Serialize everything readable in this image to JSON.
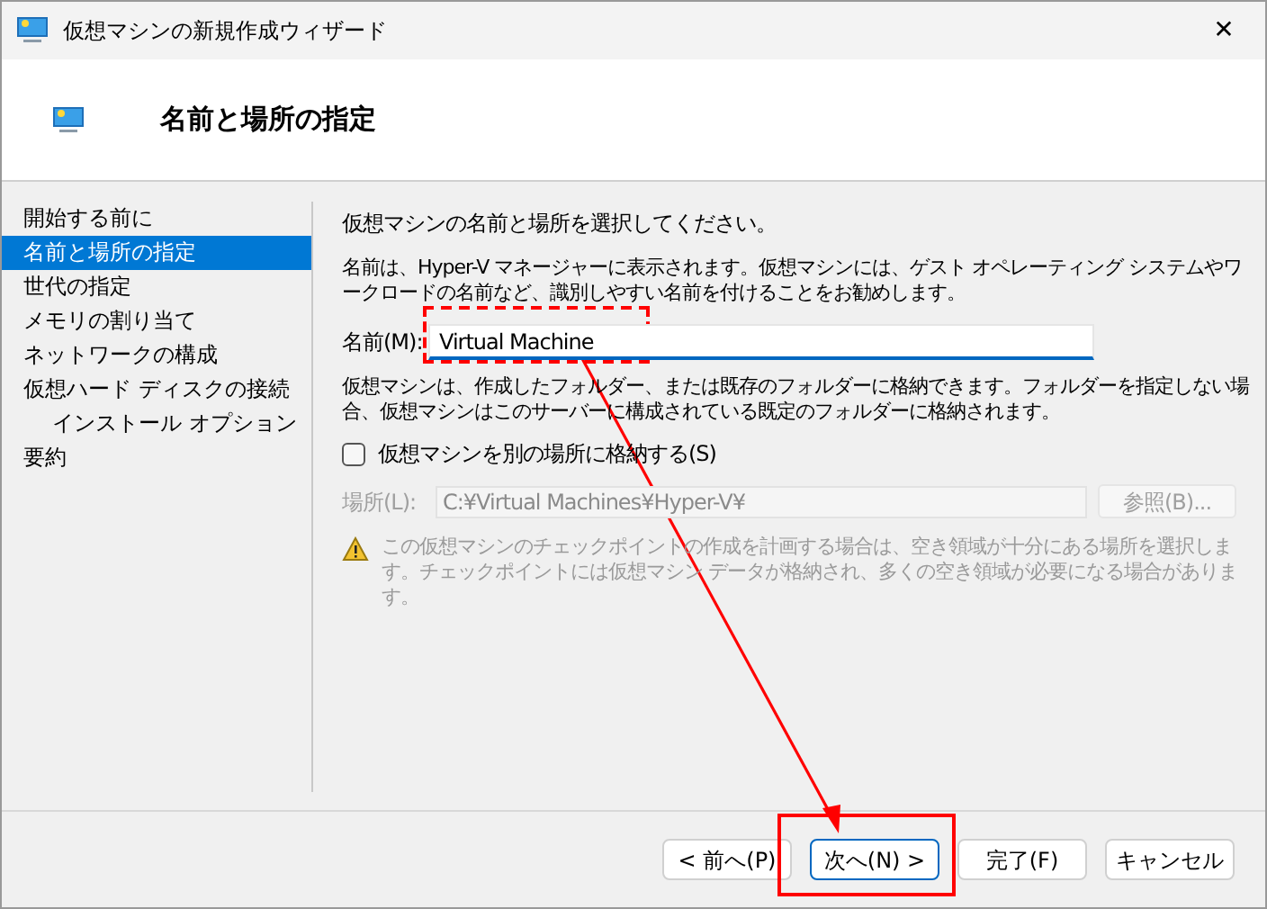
{
  "window": {
    "title": "仮想マシンの新規作成ウィザード",
    "close": "✕"
  },
  "header": {
    "title": "名前と場所の指定"
  },
  "sidebar": {
    "items": [
      {
        "label": "開始する前に",
        "selected": false
      },
      {
        "label": "名前と場所の指定",
        "selected": true
      },
      {
        "label": "世代の指定",
        "selected": false
      },
      {
        "label": "メモリの割り当て",
        "selected": false
      },
      {
        "label": "ネットワークの構成",
        "selected": false
      },
      {
        "label": "仮想ハード ディスクの接続",
        "selected": false,
        "children": [
          {
            "label": "インストール オプション",
            "selected": false
          }
        ]
      },
      {
        "label": "要約",
        "selected": false
      }
    ]
  },
  "content": {
    "instruction": "仮想マシンの名前と場所を選択してください。",
    "description": "名前は、Hyper-V マネージャーに表示されます。仮想マシンには、ゲスト オペレーティング システムやワークロードの名前など、識別しやすい名前を付けることをお勧めします。",
    "name_field": {
      "label": "名前(M):",
      "value": "Virtual Machine",
      "focused": true
    },
    "storage_note": "仮想マシンは、作成したフォルダー、または既存のフォルダーに格納できます。フォルダーを指定しない場合、仮想マシンはこのサーバーに構成されている既定のフォルダーに格納されます。",
    "store_checkbox": {
      "label": "仮想マシンを別の場所に格納する(S)",
      "checked": false
    },
    "location_field": {
      "label": "場所(L):",
      "value": "C:¥Virtual Machines¥Hyper-V¥",
      "disabled": true
    },
    "browse_button": {
      "label": "参照(B)...",
      "disabled": true
    },
    "warning": "この仮想マシンのチェックポイントの作成を計画する場合は、空き領域が十分にある場所を選択します。チェックポイントには仮想マシン データが格納され、多くの空き領域が必要になる場合があります。"
  },
  "buttons": [
    {
      "label": "< 前へ(P)",
      "default": false
    },
    {
      "label": "次へ(N) >",
      "default": true
    },
    {
      "label": "完了(F)",
      "default": false
    },
    {
      "label": "キャンセル",
      "default": false
    }
  ]
}
